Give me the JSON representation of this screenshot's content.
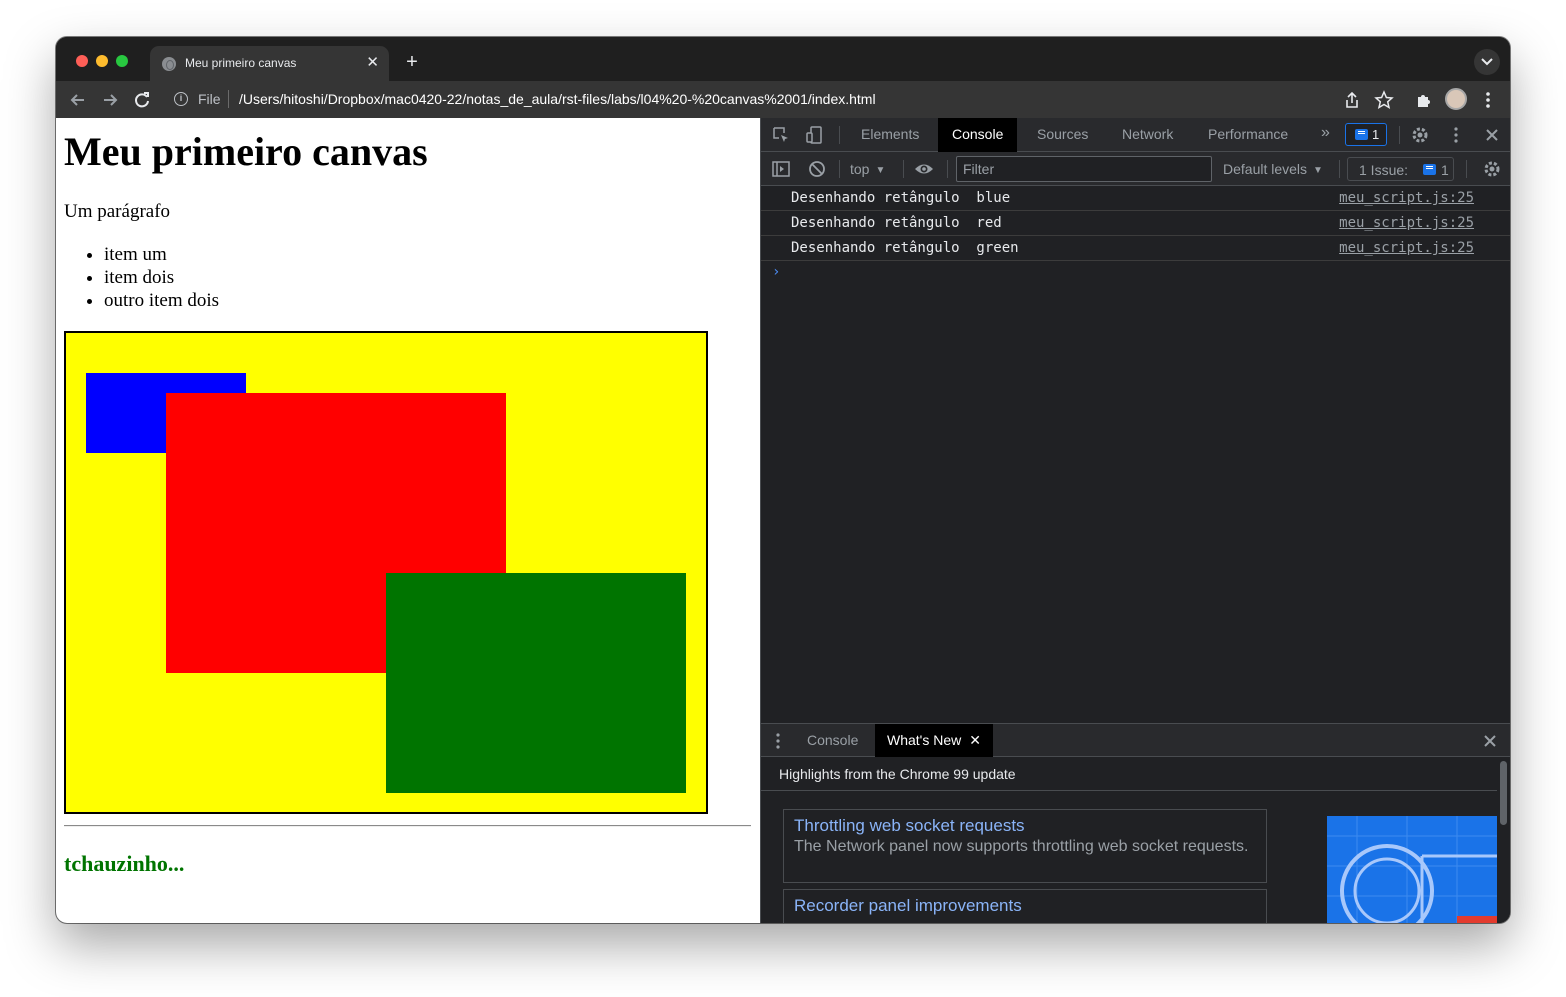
{
  "browser": {
    "tab_title": "Meu primeiro canvas",
    "url_scheme": "File",
    "url": "/Users/hitoshi/Dropbox/mac0420-22/notas_de_aula/rst-files/labs/l04%20-%20canvas%2001/index.html"
  },
  "page": {
    "heading": "Meu primeiro canvas",
    "paragraph": "Um parágrafo",
    "list_items": [
      "item um",
      "item dois",
      "outro item dois"
    ],
    "canvas": {
      "background": "#ffff00",
      "rectangles": [
        {
          "color": "blue"
        },
        {
          "color": "red"
        },
        {
          "color": "green"
        }
      ]
    },
    "footer_text": "tchauzinho..."
  },
  "devtools": {
    "tabs": [
      "Elements",
      "Console",
      "Sources",
      "Network",
      "Performance"
    ],
    "active_tab": "Console",
    "issues_badge_count": "1",
    "context": "top",
    "filter_placeholder": "Filter",
    "levels": "Default levels",
    "issues_label": "1 Issue:",
    "issues_count": "1",
    "logs": [
      {
        "message": "Desenhando retângulo  blue",
        "source": "meu_script.js:25"
      },
      {
        "message": "Desenhando retângulo  red",
        "source": "meu_script.js:25"
      },
      {
        "message": "Desenhando retângulo  green",
        "source": "meu_script.js:25"
      }
    ],
    "drawer": {
      "tabs": [
        "Console",
        "What's New"
      ],
      "active_tab": "What's New",
      "header": "Highlights from the Chrome 99 update",
      "cards": [
        {
          "title": "Throttling web socket requests",
          "description": "The Network panel now supports throttling web socket requests."
        },
        {
          "title": "Recorder panel improvements",
          "description": ""
        }
      ]
    }
  },
  "colors": {
    "accent": "#1a73e8",
    "link": "#8ab4f8",
    "footer": "#007400"
  }
}
